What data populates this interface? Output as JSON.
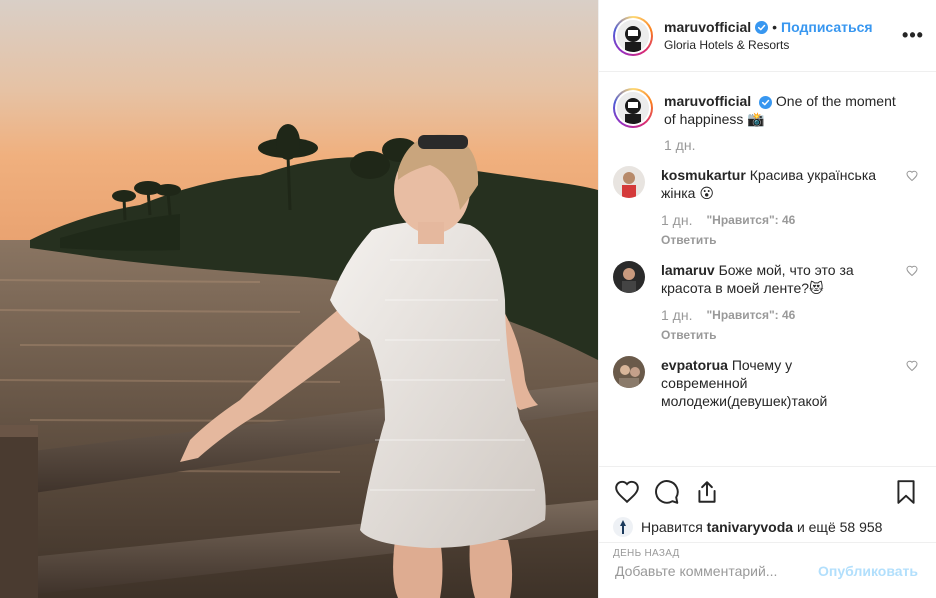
{
  "post": {
    "author": "maruvofficial",
    "follow_label": "Подписаться",
    "dot": "•",
    "location": "Gloria Hotels & Resorts",
    "more_label": "•••",
    "caption_text": "One of the moment of happiness 📸",
    "caption_time": "1 дн."
  },
  "comments": [
    {
      "user": "kosmukartur",
      "text": "Красива українська жінка 😮",
      "time": "1 дн.",
      "likes": "\"Нравится\": 46",
      "reply": "Ответить"
    },
    {
      "user": "lamaruv",
      "text": "Боже мой, что это за красота в моей ленте?😻",
      "time": "1 дн.",
      "likes": "\"Нравится\": 46",
      "reply": "Ответить"
    },
    {
      "user": "evpatorua",
      "text": "Почему у современной молодежи(девушек)такой"
    }
  ],
  "likes": {
    "prefix": "Нравится",
    "user": "tanivaryvoda",
    "suffix": "и ещё 58 958"
  },
  "post_date": "ДЕНЬ НАЗАД",
  "add_comment": {
    "placeholder": "Добавьте комментарий...",
    "publish_label": "Опубликовать"
  },
  "icons": [
    "verified-icon",
    "more-icon",
    "heart-icon",
    "comment-icon",
    "share-icon",
    "bookmark-icon"
  ],
  "colors": {
    "link": "#3897f0",
    "muted": "#999999",
    "verified": "#3897f0",
    "publish_disabled": "#b2dffc"
  }
}
